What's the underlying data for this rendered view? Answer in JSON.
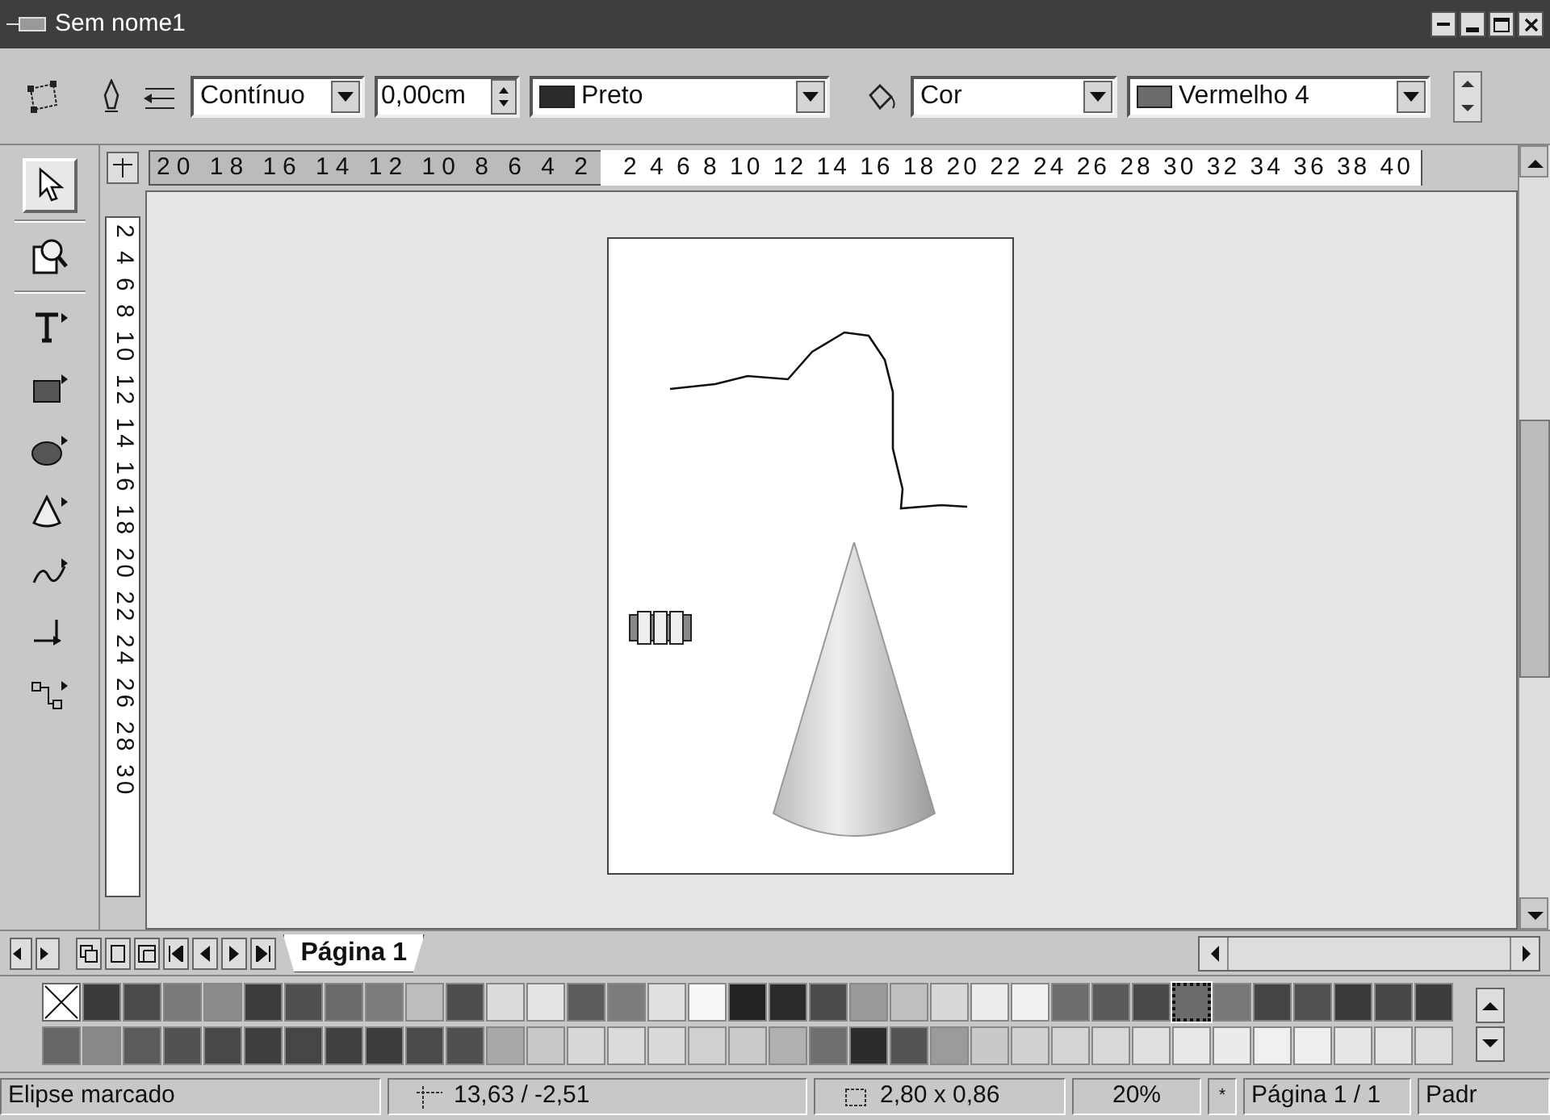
{
  "window": {
    "title": "Sem nome1"
  },
  "line_toolbar": {
    "line_style": "Contínuo",
    "line_width": "0,00cm",
    "line_color": "Preto",
    "area_style": "Cor",
    "area_color": "Vermelho 4"
  },
  "toolbox": [
    {
      "kind": "select",
      "selected": true
    },
    {
      "kind": "zoom",
      "selected": false
    },
    {
      "kind": "text",
      "selected": false
    },
    {
      "kind": "rect",
      "selected": false
    },
    {
      "kind": "ellipse",
      "selected": false
    },
    {
      "kind": "cone",
      "selected": false
    },
    {
      "kind": "curve",
      "selected": false
    },
    {
      "kind": "line",
      "selected": false
    },
    {
      "kind": "connector",
      "selected": false
    }
  ],
  "rulers": {
    "horizontal_left": "20 18 16 14 12 10 8 6 4 2",
    "horizontal_right": "2 4 6 8 10 12 14 16 18 20 22 24 26 28 30 32 34 36 38 40",
    "vertical": "2 4 6 8 10 12 14 16 18 20 22 24 26 28 30"
  },
  "tabs": [
    {
      "label": "Página 1",
      "selected": true
    }
  ],
  "palette": {
    "rows": [
      [
        {
          "kind": "none",
          "selected": false
        },
        {
          "color": "#3a3a3a",
          "selected": false
        },
        {
          "color": "#4a4a4a",
          "selected": false
        },
        {
          "color": "#7a7a7a",
          "selected": false
        },
        {
          "color": "#8a8a8a",
          "selected": false
        },
        {
          "color": "#3c3c3c",
          "selected": false
        },
        {
          "color": "#505050",
          "selected": false
        },
        {
          "color": "#6a6a6a",
          "selected": false
        },
        {
          "color": "#7b7b7b",
          "selected": false
        },
        {
          "color": "#bdbdbd",
          "selected": false
        },
        {
          "color": "#4c4c4c",
          "selected": false
        },
        {
          "color": "#dcdcdc",
          "selected": false
        },
        {
          "color": "#e4e4e4",
          "selected": false
        },
        {
          "color": "#5c5c5c",
          "selected": false
        },
        {
          "color": "#7c7c7c",
          "selected": false
        },
        {
          "color": "#e0e0e0",
          "selected": false
        },
        {
          "color": "#f8f8f8",
          "selected": false
        },
        {
          "color": "#222222",
          "selected": false
        },
        {
          "color": "#2a2a2a",
          "selected": false
        },
        {
          "color": "#4b4b4b",
          "selected": false
        },
        {
          "color": "#9a9a9a",
          "selected": false
        },
        {
          "color": "#c0c0c0",
          "selected": false
        },
        {
          "color": "#d8d8d8",
          "selected": false
        },
        {
          "color": "#ececec",
          "selected": false
        },
        {
          "color": "#f0f0f0",
          "selected": false
        },
        {
          "color": "#6c6c6c",
          "selected": false
        },
        {
          "color": "#5a5a5a",
          "selected": false
        },
        {
          "color": "#494949",
          "selected": false
        },
        {
          "color": "#6b6b6b",
          "selected": true
        },
        {
          "color": "#777777",
          "selected": false
        },
        {
          "color": "#444444",
          "selected": false
        },
        {
          "color": "#515151",
          "selected": false
        },
        {
          "color": "#393939",
          "selected": false
        },
        {
          "color": "#474747",
          "selected": false
        },
        {
          "color": "#3d3d3d",
          "selected": false
        }
      ],
      [
        {
          "color": "#666666",
          "selected": false
        },
        {
          "color": "#888888",
          "selected": false
        },
        {
          "color": "#5b5b5b",
          "selected": false
        },
        {
          "color": "#525252",
          "selected": false
        },
        {
          "color": "#484848",
          "selected": false
        },
        {
          "color": "#3e3e3e",
          "selected": false
        },
        {
          "color": "#464646",
          "selected": false
        },
        {
          "color": "#404040",
          "selected": false
        },
        {
          "color": "#3b3b3b",
          "selected": false
        },
        {
          "color": "#4a4a4a",
          "selected": false
        },
        {
          "color": "#505050",
          "selected": false
        },
        {
          "color": "#a8a8a8",
          "selected": false
        },
        {
          "color": "#c8c8c8",
          "selected": false
        },
        {
          "color": "#d7d7d7",
          "selected": false
        },
        {
          "color": "#dcdcdc",
          "selected": false
        },
        {
          "color": "#dadada",
          "selected": false
        },
        {
          "color": "#d0d0d0",
          "selected": false
        },
        {
          "color": "#cacaca",
          "selected": false
        },
        {
          "color": "#b0b0b0",
          "selected": false
        },
        {
          "color": "#707070",
          "selected": false
        },
        {
          "color": "#2c2c2c",
          "selected": false
        },
        {
          "color": "#545454",
          "selected": false
        },
        {
          "color": "#9b9b9b",
          "selected": false
        },
        {
          "color": "#c9c9c9",
          "selected": false
        },
        {
          "color": "#d1d1d1",
          "selected": false
        },
        {
          "color": "#d4d4d4",
          "selected": false
        },
        {
          "color": "#d9d9d9",
          "selected": false
        },
        {
          "color": "#e0e0e0",
          "selected": false
        },
        {
          "color": "#e8e8e8",
          "selected": false
        },
        {
          "color": "#ebebeb",
          "selected": false
        },
        {
          "color": "#f0f0f0",
          "selected": false
        },
        {
          "color": "#efefef",
          "selected": false
        },
        {
          "color": "#e7e7e7",
          "selected": false
        },
        {
          "color": "#e4e4e4",
          "selected": false
        },
        {
          "color": "#dddddd",
          "selected": false
        }
      ]
    ]
  },
  "status_bar": {
    "message": "Elipse marcado",
    "position": "13,63 / -2,51",
    "size": "2,80 x 0,86",
    "zoom": "20%",
    "modified": "*",
    "page": "Página 1 / 1",
    "style": "Padr"
  }
}
